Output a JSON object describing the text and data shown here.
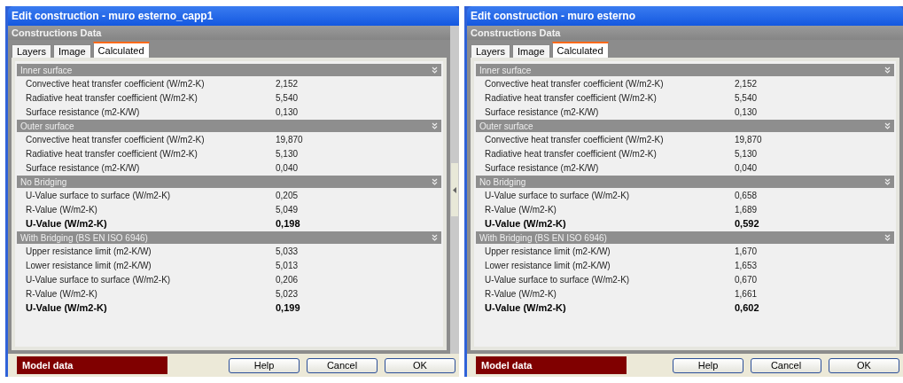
{
  "windows": [
    {
      "title": "Edit construction - muro esterno_capp1",
      "header": "Constructions Data",
      "splitter": true,
      "tabs": [
        {
          "label": "Layers",
          "selected": false
        },
        {
          "label": "Image",
          "selected": false
        },
        {
          "label": "Calculated",
          "selected": true
        }
      ],
      "sections": [
        {
          "title": "Inner surface",
          "rows": [
            {
              "kind": "normal",
              "label": "Convective heat transfer coefficient (W/m2-K)",
              "value": "2,152"
            },
            {
              "kind": "normal",
              "label": "Radiative heat transfer coefficient (W/m2-K)",
              "value": "5,540"
            },
            {
              "kind": "normal",
              "label": "Surface resistance (m2-K/W)",
              "value": "0,130"
            }
          ]
        },
        {
          "title": "Outer surface",
          "rows": [
            {
              "kind": "normal",
              "label": "Convective heat transfer coefficient (W/m2-K)",
              "value": "19,870"
            },
            {
              "kind": "normal",
              "label": "Radiative heat transfer coefficient (W/m2-K)",
              "value": "5,130"
            },
            {
              "kind": "normal",
              "label": "Surface resistance (m2-K/W)",
              "value": "0,040"
            }
          ]
        },
        {
          "title": "No Bridging",
          "rows": [
            {
              "kind": "normal",
              "label": "U-Value surface to surface (W/m2-K)",
              "value": "0,205"
            },
            {
              "kind": "normal",
              "label": "R-Value (W/m2-K)",
              "value": "5,049"
            },
            {
              "kind": "total",
              "label": "U-Value (W/m2-K)",
              "value": "0,198"
            }
          ]
        },
        {
          "title": "With Bridging (BS EN ISO 6946)",
          "rows": [
            {
              "kind": "normal",
              "label": "Upper resistance limit (m2-K/W)",
              "value": "5,033"
            },
            {
              "kind": "normal",
              "label": "Lower resistance limit (m2-K/W)",
              "value": "5,013"
            },
            {
              "kind": "normal",
              "label": "U-Value surface to surface (W/m2-K)",
              "value": "0,206"
            },
            {
              "kind": "normal",
              "label": "R-Value (W/m2-K)",
              "value": "5,023"
            },
            {
              "kind": "total",
              "label": "U-Value (W/m2-K)",
              "value": "0,199"
            }
          ]
        }
      ],
      "model_data": "Model data",
      "buttons": [
        "Help",
        "Cancel",
        "OK"
      ]
    },
    {
      "title": "Edit construction - muro esterno",
      "header": "Constructions Data",
      "splitter": false,
      "tabs": [
        {
          "label": "Layers",
          "selected": false
        },
        {
          "label": "Image",
          "selected": false
        },
        {
          "label": "Calculated",
          "selected": true
        }
      ],
      "sections": [
        {
          "title": "Inner surface",
          "rows": [
            {
              "kind": "normal",
              "label": "Convective heat transfer coefficient (W/m2-K)",
              "value": "2,152"
            },
            {
              "kind": "normal",
              "label": "Radiative heat transfer coefficient (W/m2-K)",
              "value": "5,540"
            },
            {
              "kind": "normal",
              "label": "Surface resistance (m2-K/W)",
              "value": "0,130"
            }
          ]
        },
        {
          "title": "Outer surface",
          "rows": [
            {
              "kind": "normal",
              "label": "Convective heat transfer coefficient (W/m2-K)",
              "value": "19,870"
            },
            {
              "kind": "normal",
              "label": "Radiative heat transfer coefficient (W/m2-K)",
              "value": "5,130"
            },
            {
              "kind": "normal",
              "label": "Surface resistance (m2-K/W)",
              "value": "0,040"
            }
          ]
        },
        {
          "title": "No Bridging",
          "rows": [
            {
              "kind": "normal",
              "label": "U-Value surface to surface (W/m2-K)",
              "value": "0,658"
            },
            {
              "kind": "normal",
              "label": "R-Value (W/m2-K)",
              "value": "1,689"
            },
            {
              "kind": "total",
              "label": "U-Value (W/m2-K)",
              "value": "0,592"
            }
          ]
        },
        {
          "title": "With Bridging (BS EN ISO 6946)",
          "rows": [
            {
              "kind": "normal",
              "label": "Upper resistance limit (m2-K/W)",
              "value": "1,670"
            },
            {
              "kind": "normal",
              "label": "Lower resistance limit (m2-K/W)",
              "value": "1,653"
            },
            {
              "kind": "normal",
              "label": "U-Value surface to surface (W/m2-K)",
              "value": "0,670"
            },
            {
              "kind": "normal",
              "label": "R-Value (W/m2-K)",
              "value": "1,661"
            },
            {
              "kind": "total",
              "label": "U-Value (W/m2-K)",
              "value": "0,602"
            }
          ]
        }
      ],
      "model_data": "Model data",
      "buttons": [
        "Help",
        "Cancel",
        "OK"
      ]
    }
  ]
}
